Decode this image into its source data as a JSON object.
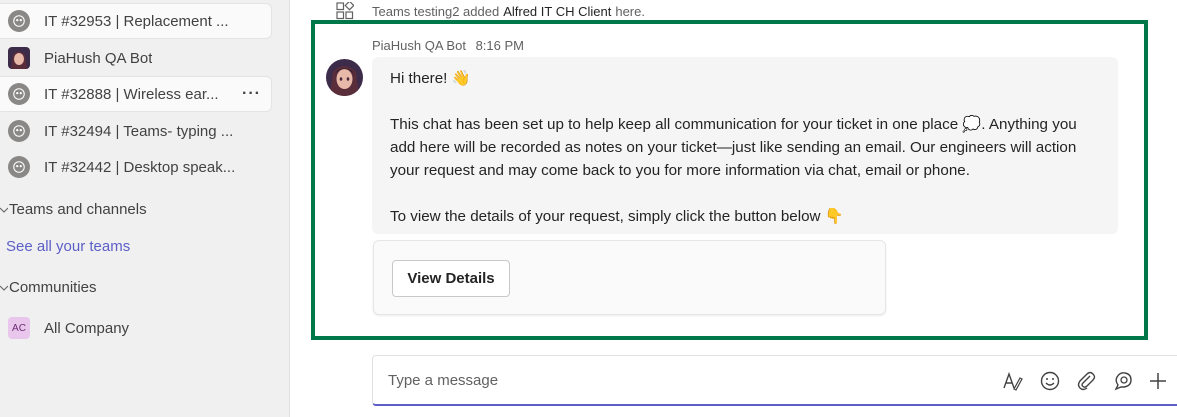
{
  "sidebar": {
    "chats": [
      {
        "label": "IT #32953 | Replacement ..."
      },
      {
        "label": "PiaHush QA Bot"
      },
      {
        "label": "IT #32888 | Wireless ear...",
        "more": "···"
      },
      {
        "label": "IT #32494 | Teams- typing ..."
      },
      {
        "label": "IT #32442 | Desktop speak..."
      }
    ],
    "teams_header": "Teams and channels",
    "see_all": "See all your teams",
    "communities_header": "Communities",
    "all_company": {
      "badge": "AC",
      "label": "All Company"
    }
  },
  "system_message": {
    "icon": "apps-icon",
    "prefix": "Teams testing2 added",
    "app_name": "Alfred IT CH Client",
    "suffix": "here."
  },
  "message": {
    "sender": "PiaHush QA Bot",
    "time": "8:16 PM",
    "greeting": "Hi there! 👋",
    "line1": "This chat has been set up to help keep all communication for your ticket in one place 💭. Anything you add here will be recorded as notes on your ticket—just like sending an email. Our engineers will action your request and may come back to you for more information via chat, email or phone.",
    "line2": "To view the details of your request, simply click the button below 👇",
    "card_button": "View Details"
  },
  "composer": {
    "placeholder": "Type a message",
    "tools": [
      "format-icon",
      "emoji-icon",
      "attach-icon",
      "loop-icon",
      "plus-icon"
    ]
  },
  "colors": {
    "accent": "#5b5fc7",
    "highlight_border": "#00784a",
    "sidebar_bg": "#f0f0f0"
  }
}
